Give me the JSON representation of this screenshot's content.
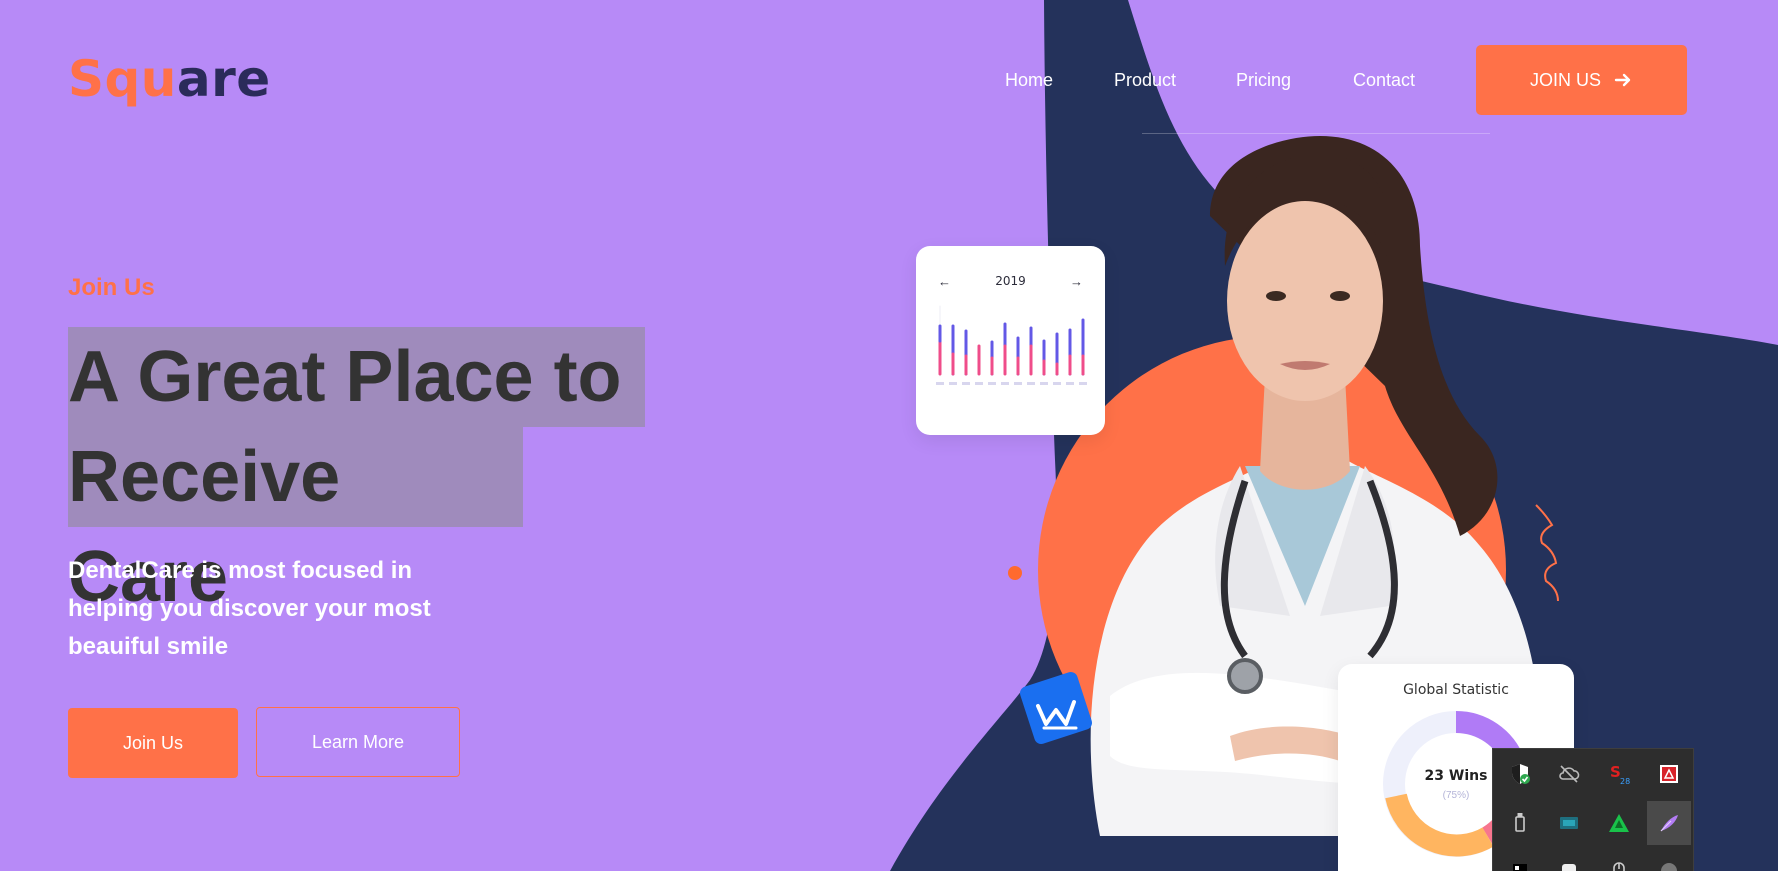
{
  "logo": {
    "part1": "Squ",
    "part2": "are"
  },
  "nav": {
    "items": [
      "Home",
      "Product",
      "Pricing",
      "Contact"
    ],
    "cta_label": "JOIN US"
  },
  "hero": {
    "eyebrow": "Join Us",
    "headline_line1": "A Great Place to",
    "headline_line2": "Receive Care",
    "subcopy": "DentalCare is most focused in helping you discover your most beauiful smile",
    "primary_button": "Join Us",
    "secondary_button": "Learn More"
  },
  "bar_card": {
    "year": "2019",
    "prev_arrow": "←",
    "next_arrow": "→"
  },
  "stat_card": {
    "title": "Global Statistic",
    "center_value": "23 Wins",
    "center_sub": "(75%)"
  },
  "tray": {
    "icons": [
      "shield-check-icon",
      "cloud-off-icon",
      "s-app-icon",
      "pdf-app-icon",
      "usb-drive-icon",
      "monitor-app-icon",
      "green-triangle-app-icon",
      "purple-feather-icon",
      "black-app-icon",
      "white-app-icon",
      "mouse-icon",
      "grey-app-icon"
    ]
  },
  "colors": {
    "background": "#b78af7",
    "navy": "#24325b",
    "accent": "#ff7148",
    "headline": "#333333"
  }
}
